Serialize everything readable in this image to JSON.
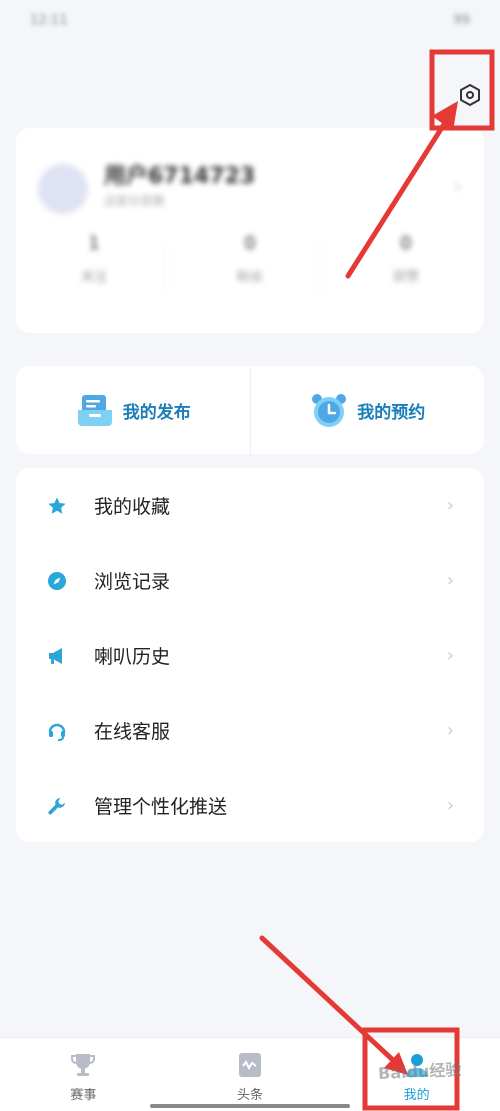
{
  "status_bar": {
    "time": "12:11",
    "battery": "99"
  },
  "profile": {
    "username": "用户6714723",
    "subtitle": "这家伙很懒",
    "stats": [
      {
        "value": "1",
        "label": "关注"
      },
      {
        "value": "0",
        "label": "粉丝"
      },
      {
        "value": "0",
        "label": "获赞"
      }
    ]
  },
  "quick_actions": [
    {
      "label": "我的发布",
      "icon": "document-tray-icon"
    },
    {
      "label": "我的预约",
      "icon": "alarm-clock-icon"
    }
  ],
  "menu": {
    "items": [
      {
        "label": "我的收藏",
        "icon": "star-icon"
      },
      {
        "label": "浏览记录",
        "icon": "compass-icon"
      },
      {
        "label": "喇叭历史",
        "icon": "megaphone-icon"
      },
      {
        "label": "在线客服",
        "icon": "headset-icon"
      },
      {
        "label": "管理个性化推送",
        "icon": "wrench-icon"
      }
    ]
  },
  "tabbar": {
    "tabs": [
      {
        "label": "赛事",
        "icon": "trophy-icon"
      },
      {
        "label": "头条",
        "icon": "news-icon"
      },
      {
        "label": "我的",
        "icon": "person-icon",
        "active": true
      }
    ]
  },
  "watermark": "Baidu经验",
  "colors": {
    "accent": "#1a9fd6",
    "quick_label": "#1a7eb8",
    "annotation": "#e53935",
    "background": "#f4f6fa"
  }
}
